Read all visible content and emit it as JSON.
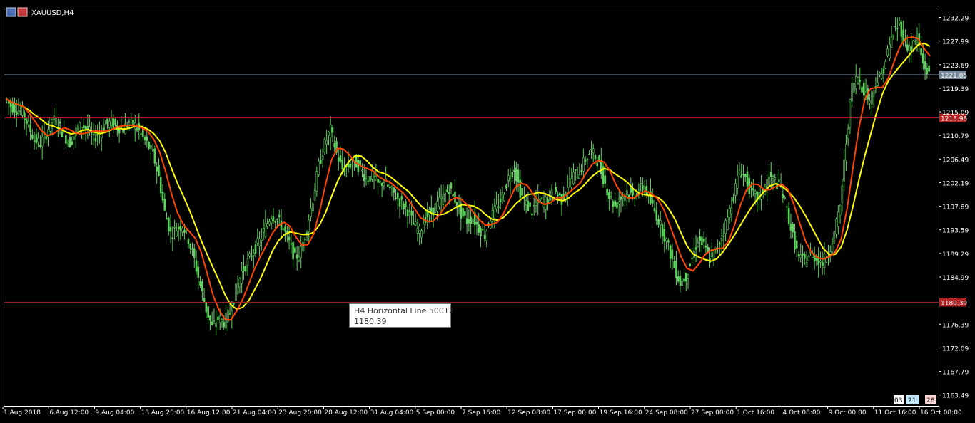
{
  "window": {
    "symbol_title": "XAUUSD,H4",
    "icons": [
      "window-menu-icon",
      "symbol-icon"
    ]
  },
  "colors": {
    "background": "#000000",
    "frame": "#ffffff",
    "candle": "#5fd35f",
    "ma_fast": "#ff4500",
    "ma_slow": "#ffff00",
    "hline_support": "#b22222",
    "hline_resist": "#b22222",
    "current_price_line": "#778899",
    "price_label_bg_red": "#b22222",
    "price_label_bg_gray": "#778899"
  },
  "tooltip": {
    "line1": "H4 Horizontal Line 50012",
    "line2": "1180.39"
  },
  "corner_badges": [
    "03",
    "21",
    "28"
  ],
  "chart_data": {
    "type": "candlestick",
    "title": "XAUUSD,H4",
    "ylim": [
      1161.5,
      1234.3
    ],
    "y_tick_labels": [
      "1232.29",
      "1227.99",
      "1223.69",
      "1219.39",
      "1215.09",
      "1210.79",
      "1206.49",
      "1202.19",
      "1197.89",
      "1193.59",
      "1189.29",
      "1184.99",
      "1176.39",
      "1172.09",
      "1167.79",
      "1163.49"
    ],
    "x_tick_labels": [
      "1 Aug 2018",
      "6 Aug 12:00",
      "9 Aug 04:00",
      "13 Aug 20:00",
      "16 Aug 12:00",
      "21 Aug 04:00",
      "23 Aug 20:00",
      "28 Aug 12:00",
      "31 Aug 04:00",
      "5 Sep 00:00",
      "7 Sep 16:00",
      "12 Sep 08:00",
      "17 Sep 00:00",
      "19 Sep 16:00",
      "24 Sep 08:00",
      "27 Sep 00:00",
      "1 Oct 16:00",
      "4 Oct 08:00",
      "9 Oct 00:00",
      "11 Oct 16:00",
      "16 Oct 08:00"
    ],
    "horizontal_lines": [
      {
        "name": "current",
        "value": 1221.85,
        "label": "1221.85"
      },
      {
        "name": "upper",
        "value": 1213.98,
        "label": "1213.98"
      },
      {
        "name": "support",
        "value": 1180.39,
        "label": "1180.39"
      }
    ],
    "close_series": [
      1217.5,
      1216.2,
      1215.6,
      1214.9,
      1212.5,
      1210.0,
      1209.3,
      1211.2,
      1213.8,
      1212.9,
      1210.8,
      1209.4,
      1211.5,
      1212.7,
      1211.8,
      1210.4,
      1211.3,
      1212.8,
      1213.1,
      1212.4,
      1211.9,
      1213.2,
      1212.6,
      1210.9,
      1209.3,
      1207.5,
      1203.2,
      1196.8,
      1192.9,
      1193.8,
      1194.5,
      1191.8,
      1188.1,
      1183.5,
      1179.1,
      1175.9,
      1177.4,
      1176.8,
      1178.5,
      1182.6,
      1185.9,
      1187.7,
      1189.9,
      1191.5,
      1194.2,
      1196.3,
      1195.5,
      1193.8,
      1191.2,
      1188.4,
      1189.8,
      1194.1,
      1199.2,
      1205.3,
      1209.2,
      1211.8,
      1207.5,
      1204.6,
      1205.2,
      1206.1,
      1204.8,
      1202.9,
      1203.4,
      1201.8,
      1202.5,
      1200.9,
      1199.8,
      1198.4,
      1197.1,
      1194.5,
      1193.2,
      1195.9,
      1196.8,
      1198.2,
      1199.5,
      1201.2,
      1199.1,
      1196.5,
      1195.2,
      1195.8,
      1193.9,
      1192.7,
      1195.8,
      1197.5,
      1199.8,
      1203.1,
      1204.9,
      1200.5,
      1198.3,
      1196.9,
      1199.2,
      1198.4,
      1199.8,
      1200.5,
      1199.1,
      1201.8,
      1203.5,
      1204.2,
      1206.5,
      1207.9,
      1206.3,
      1203.1,
      1199.8,
      1197.9,
      1199.4,
      1200.7,
      1199.6,
      1200.9,
      1201.5,
      1198.6,
      1196.2,
      1193.5,
      1190.4,
      1186.8,
      1183.9,
      1185.2,
      1188.5,
      1191.9,
      1190.6,
      1188.3,
      1189.7,
      1192.4,
      1195.8,
      1199.9,
      1204.5,
      1203.1,
      1200.3,
      1199.4,
      1200.8,
      1203.2,
      1202.5,
      1201.1,
      1197.2,
      1192.3,
      1188.5,
      1187.9,
      1189.2,
      1188.4,
      1187.6,
      1189.5,
      1192.8,
      1197.9,
      1209.6,
      1219.8,
      1221.5,
      1218.9,
      1217.2,
      1220.4,
      1221.8,
      1225.9,
      1229.6,
      1231.2,
      1227.3,
      1226.8,
      1228.5,
      1223.9,
      1221.85
    ]
  }
}
